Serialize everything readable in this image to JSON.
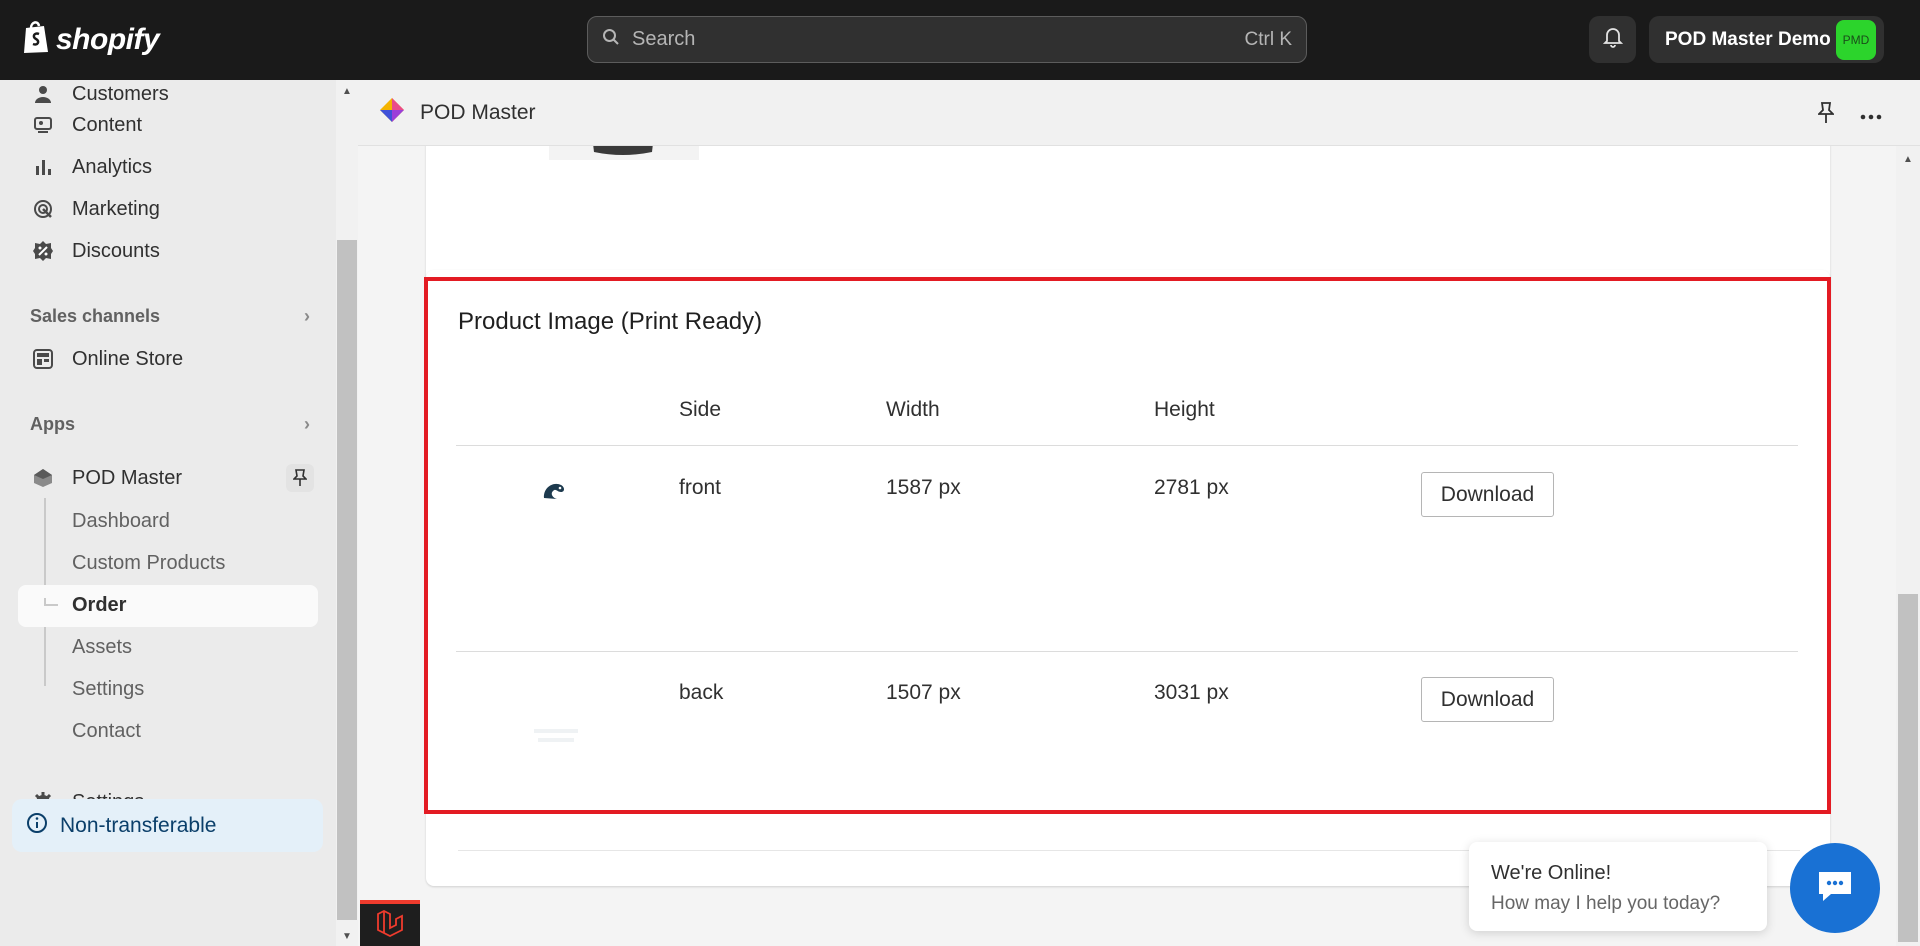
{
  "topbar": {
    "brand": "shopify",
    "search_placeholder": "Search",
    "search_shortcut": "Ctrl K",
    "account_name": "POD Master Demo",
    "avatar_initials": "PMD"
  },
  "sidebar": {
    "items": [
      {
        "label": "Customers",
        "icon": "person-icon"
      },
      {
        "label": "Content",
        "icon": "content-icon"
      },
      {
        "label": "Analytics",
        "icon": "bar-chart-icon"
      },
      {
        "label": "Marketing",
        "icon": "target-icon"
      },
      {
        "label": "Discounts",
        "icon": "discount-icon"
      }
    ],
    "sales_channels_label": "Sales channels",
    "online_store_label": "Online Store",
    "apps_label": "Apps",
    "pod_master_label": "POD Master",
    "sub_items": [
      "Dashboard",
      "Custom Products",
      "Order",
      "Assets",
      "Settings",
      "Contact"
    ],
    "settings_label": "Settings",
    "non_transferable_label": "Non-transferable"
  },
  "app_header": {
    "title": "POD Master"
  },
  "card": {
    "title": "Product Image (Print Ready)",
    "columns": [
      "Side",
      "Width",
      "Height"
    ],
    "rows": [
      {
        "side": "front",
        "width": "1587 px",
        "height": "2781 px",
        "action": "Download"
      },
      {
        "side": "back",
        "width": "1507 px",
        "height": "3031 px",
        "action": "Download"
      }
    ]
  },
  "chat": {
    "title": "We're Online!",
    "subtitle": "How may I help you today?"
  },
  "colors": {
    "accent_highlight": "#e31b23",
    "topbar_bg": "#1a1a1a",
    "chat_blue": "#1971d4",
    "avatar_green": "#2cd42c"
  }
}
